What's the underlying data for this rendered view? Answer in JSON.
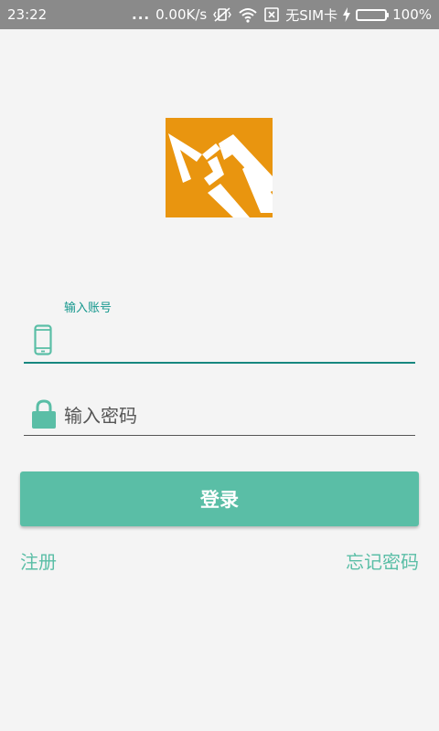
{
  "status_bar": {
    "time": "23:22",
    "dots": "...",
    "speed": "0.00K/s",
    "sim": "无SIM卡",
    "battery": "100%",
    "battery_level": 1.0,
    "battery_color": "#5dc44a"
  },
  "login": {
    "account_label": "输入账号",
    "account_value": "",
    "password_placeholder": "输入密码",
    "login_button": "登录",
    "register_link": "注册",
    "forgot_link": "忘记密码"
  },
  "icons": {
    "logo": "app-logo",
    "account": "phone-icon",
    "password": "lock-icon"
  },
  "colors": {
    "accent": "#5abea6",
    "focus_line": "#17877f",
    "label": "#14978d",
    "logo_bg": "#e9950f"
  }
}
